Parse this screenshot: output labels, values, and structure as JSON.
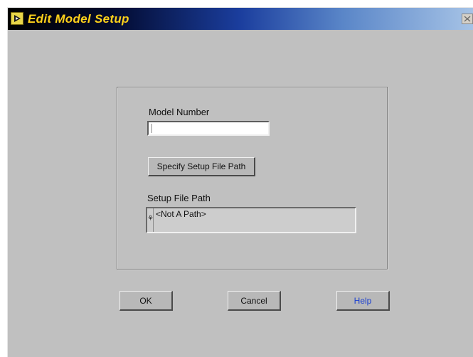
{
  "window": {
    "title": "Edit Model Setup",
    "icons": {
      "app": "labview-vi-icon",
      "close": "close-icon"
    }
  },
  "form": {
    "model_number_label": "Model Number",
    "model_number_value": "",
    "specify_path_button": "Specify Setup File Path",
    "setup_path_label": "Setup File Path",
    "setup_path_value": "<Not A Path>",
    "path_icon": "path-icon"
  },
  "buttons": {
    "ok": "OK",
    "cancel": "Cancel",
    "help": "Help"
  },
  "colors": {
    "title_text": "#ffd21a",
    "window_bg": "#c0c0c0",
    "help_text": "#1a3fd0"
  }
}
